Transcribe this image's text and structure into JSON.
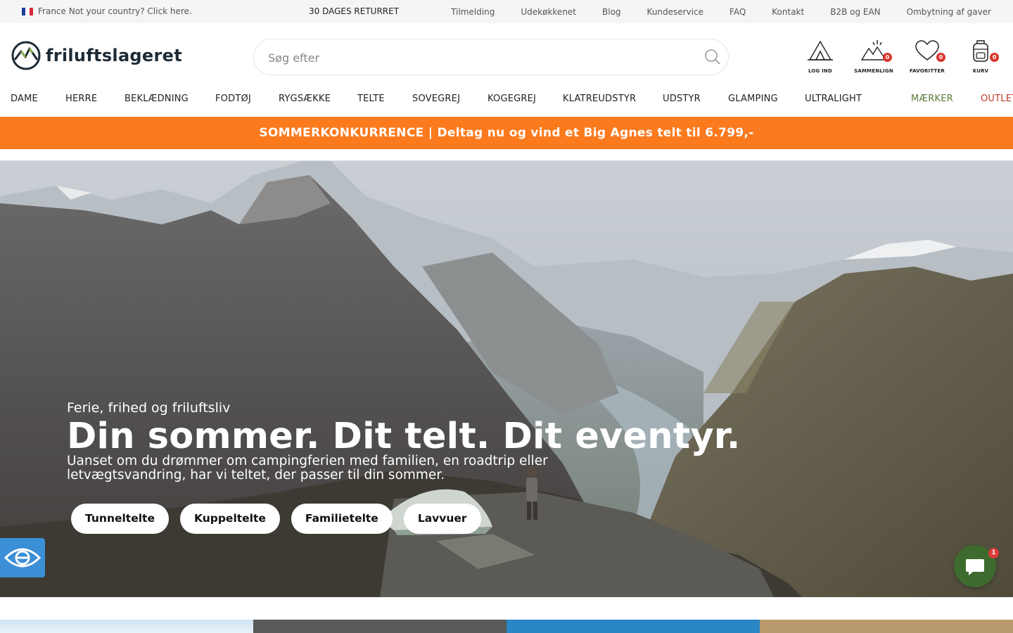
{
  "topbar": {
    "country_text": "France Not your country? Click here.",
    "returns": "30 DAGES RETURRET",
    "links": [
      "Tilmelding",
      "Udekøkkenet",
      "Blog",
      "Kundeservice",
      "FAQ",
      "Kontakt",
      "B2B og EAN",
      "Ombytning af gaver"
    ]
  },
  "header": {
    "logo_text": "friluftslageret",
    "search_placeholder": "Søg efter",
    "icons": [
      {
        "label": "LOG IND",
        "icon": "tent-icon"
      },
      {
        "label": "SAMMENLIGN",
        "icon": "compare-icon",
        "count": "0"
      },
      {
        "label": "FAVORITTER",
        "icon": "heart-icon",
        "count": "0"
      },
      {
        "label": "KURV",
        "icon": "backpack-icon",
        "count": "0"
      }
    ]
  },
  "nav": {
    "items": [
      "DAME",
      "HERRE",
      "BEKLÆDNING",
      "FODTØJ",
      "RYGSÆKKE",
      "TELTE",
      "SOVEGREJ",
      "KOGEGREJ",
      "KLATREUDSTYR",
      "UDSTYR",
      "GLAMPING",
      "ULTRALIGHT"
    ],
    "brands": "MÆRKER",
    "outlet": "OUTLET"
  },
  "promo": "SOMMERKONKURRENCE | Deltag nu og vind et Big Agnes telt til 6.799,-",
  "hero": {
    "eyebrow": "Ferie, frihed og friluftsliv",
    "title": "Din sommer. Dit telt. Dit eventyr.",
    "subtitle": "Uanset om du drømmer om campingferien med familien, en roadtrip eller letvægtsvandring, har vi teltet, der passer til din sommer.",
    "buttons": [
      "Tunneltelte",
      "Kuppeltelte",
      "Familietelte",
      "Lavvuer"
    ]
  },
  "chat": {
    "unread": "1"
  },
  "colors": {
    "promo": "#fc7a1e",
    "brand_nav": "#5c7a3a",
    "outlet_nav": "#c0392b",
    "badge": "#d9342b",
    "chat": "#3d6b2e",
    "a11y": "#3b8fd6"
  }
}
